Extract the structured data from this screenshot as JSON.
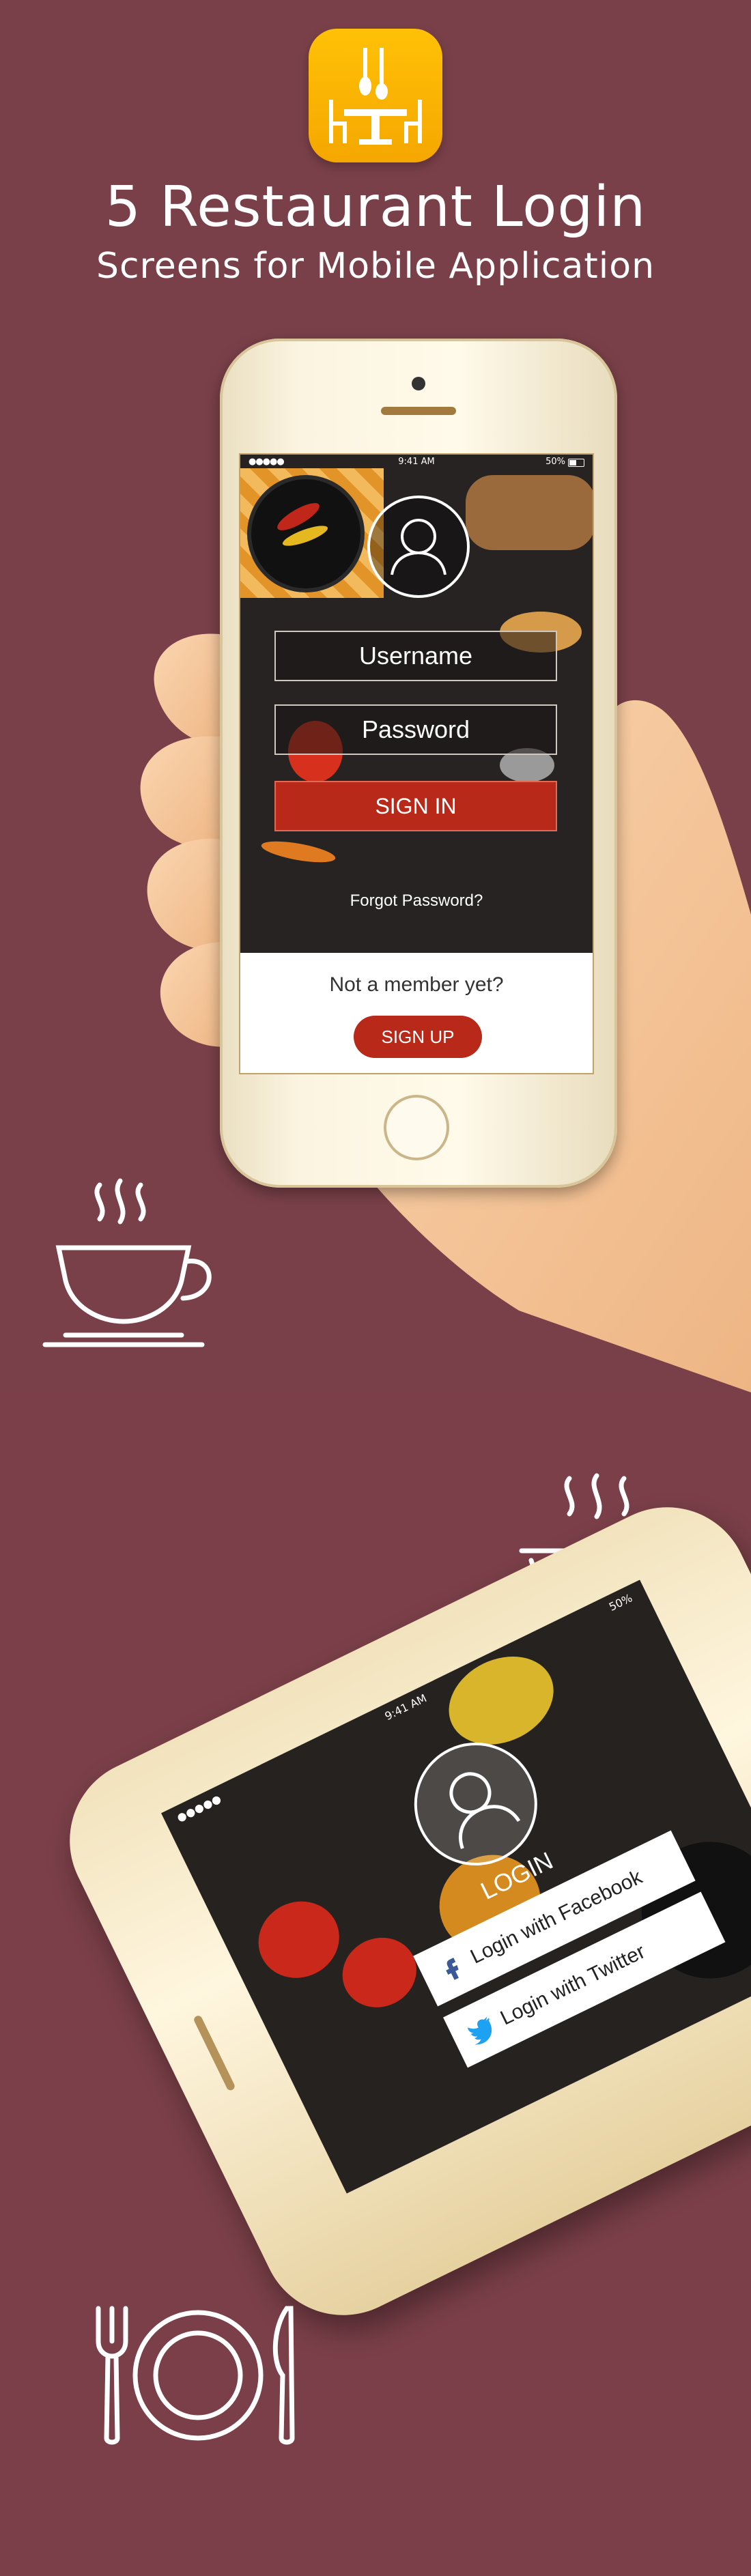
{
  "header": {
    "title": "5 Restaurant Login",
    "subtitle": "Screens for Mobile Application",
    "app_icon": "restaurant-table-icon"
  },
  "screen1": {
    "status": {
      "signal": "●●●●● ",
      "time": "9:41 AM",
      "battery": "50%"
    },
    "username_placeholder": "Username",
    "password_placeholder": "Password",
    "signin_label": "SIGN IN",
    "forgot_label": "Forgot Password?",
    "not_member_label": "Not a member yet?",
    "signup_label": "SIGN UP"
  },
  "screen2": {
    "status": {
      "signal": "●●●●●",
      "time": "9:41 AM",
      "battery": "50%"
    },
    "login_label": "LOGIN",
    "facebook_label": "Login with Facebook",
    "twitter_label": "Login with Twitter"
  },
  "decor_icons": [
    "coffee-cup-icon",
    "barbecue-grill-icon",
    "plate-cutlery-icon"
  ],
  "colors": {
    "background": "#7a4049",
    "accent": "#b8291a",
    "app_icon": "#ffc107",
    "facebook": "#3b5998",
    "twitter": "#1da1f2"
  }
}
